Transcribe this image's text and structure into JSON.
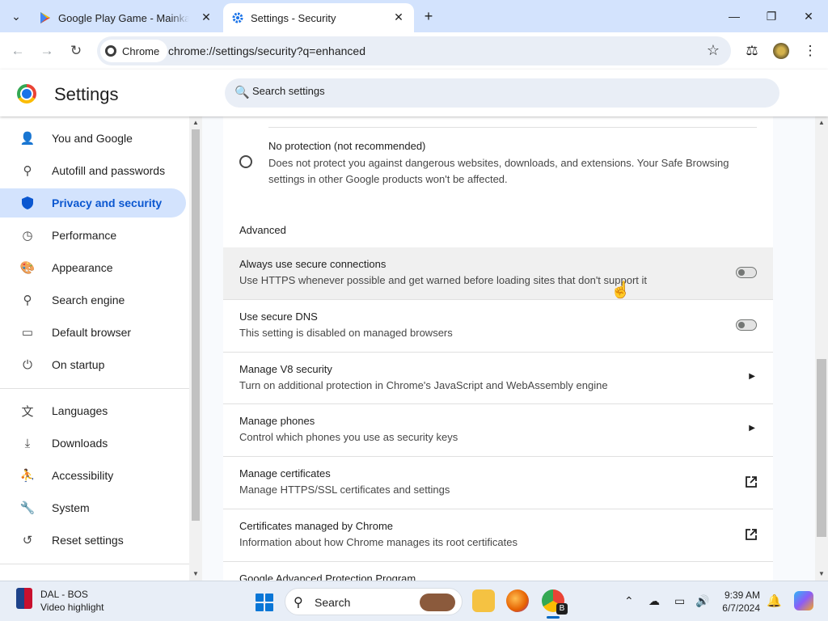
{
  "tabs": [
    {
      "title": "Google Play Game - Mainkan g",
      "icon": "google-play-icon"
    },
    {
      "title": "Settings - Security",
      "icon": "settings-gear-icon"
    }
  ],
  "toolbar": {
    "chip_label": "Chrome",
    "url": "chrome://settings/security?q=enhanced"
  },
  "header": {
    "title": "Settings",
    "search_placeholder": "Search settings"
  },
  "sidebar": {
    "items": [
      {
        "label": "You and Google",
        "icon": "person-icon"
      },
      {
        "label": "Autofill and passwords",
        "icon": "key-icon"
      },
      {
        "label": "Privacy and security",
        "icon": "shield-icon",
        "active": true
      },
      {
        "label": "Performance",
        "icon": "speedometer-icon"
      },
      {
        "label": "Appearance",
        "icon": "palette-icon"
      },
      {
        "label": "Search engine",
        "icon": "search-icon"
      },
      {
        "label": "Default browser",
        "icon": "browser-window-icon"
      },
      {
        "label": "On startup",
        "icon": "power-icon"
      },
      {
        "label": "Languages",
        "icon": "translate-icon"
      },
      {
        "label": "Downloads",
        "icon": "download-icon"
      },
      {
        "label": "Accessibility",
        "icon": "accessibility-icon"
      },
      {
        "label": "System",
        "icon": "wrench-icon"
      },
      {
        "label": "Reset settings",
        "icon": "reset-icon"
      }
    ]
  },
  "main": {
    "no_protection": {
      "title": "No protection (not recommended)",
      "description": "Does not protect you against dangerous websites, downloads, and extensions. Your Safe Browsing settings in other Google products won't be affected."
    },
    "advanced_heading": "Advanced",
    "rows": [
      {
        "title": "Always use secure connections",
        "description": "Use HTTPS whenever possible and get warned before loading sites that don't support it",
        "control": "toggle",
        "on": false
      },
      {
        "title": "Use secure DNS",
        "description": "This setting is disabled on managed browsers",
        "control": "toggle",
        "on": false
      },
      {
        "title": "Manage V8 security",
        "description": "Turn on additional protection in Chrome's JavaScript and WebAssembly engine",
        "control": "arrow"
      },
      {
        "title": "Manage phones",
        "description": "Control which phones you use as security keys",
        "control": "arrow"
      },
      {
        "title": "Manage certificates",
        "description": "Manage HTTPS/SSL certificates and settings",
        "control": "external"
      },
      {
        "title": "Certificates managed by Chrome",
        "description": "Information about how Chrome manages its root certificates",
        "control": "external"
      },
      {
        "title": "Google Advanced Protection Program",
        "description": "",
        "control": "external"
      }
    ]
  },
  "taskbar": {
    "widget_line1": "DAL - BOS",
    "widget_line2": "Video highlight",
    "search_label": "Search",
    "time": "9:39 AM",
    "date": "6/7/2024"
  },
  "colors": {
    "accent": "#0b57d0",
    "tabbar": "#d3e3fd",
    "active_nav_bg": "#d3e3fd"
  }
}
